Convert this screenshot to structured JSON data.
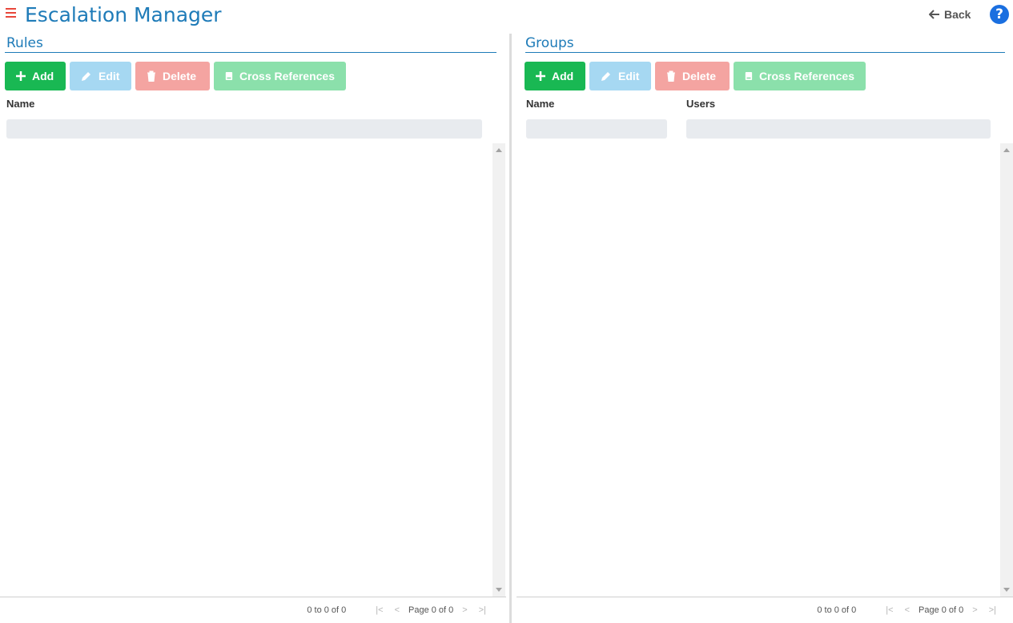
{
  "header": {
    "title": "Escalation Manager",
    "back_label": "Back",
    "help_glyph": "?"
  },
  "colors": {
    "accent": "#1e7bb8",
    "menu": "#e8473b",
    "add": "#19b853",
    "edit": "#a6d8f2",
    "delete": "#f4a4a1",
    "cross_references": "#8be0ab",
    "help": "#1a6fe0"
  },
  "rules": {
    "title": "Rules",
    "toolbar": {
      "add": "Add",
      "edit": "Edit",
      "delete": "Delete",
      "cross_references": "Cross References"
    },
    "columns": [
      "Name"
    ],
    "filters": [
      ""
    ],
    "footer": {
      "summary": "0 to 0 of 0",
      "page": "Page 0 of 0"
    }
  },
  "groups": {
    "title": "Groups",
    "toolbar": {
      "add": "Add",
      "edit": "Edit",
      "delete": "Delete",
      "cross_references": "Cross References"
    },
    "columns": [
      "Name",
      "Users"
    ],
    "filters": [
      "",
      ""
    ],
    "footer": {
      "summary": "0 to 0 of 0",
      "page": "Page 0 of 0"
    }
  },
  "icons": {
    "menu": "hamburger-menu-icon",
    "back": "arrow-left-icon",
    "help": "question-circle-icon",
    "add": "plus-icon",
    "edit": "pencil-icon",
    "delete": "trash-icon",
    "cross_references": "book-icon"
  }
}
